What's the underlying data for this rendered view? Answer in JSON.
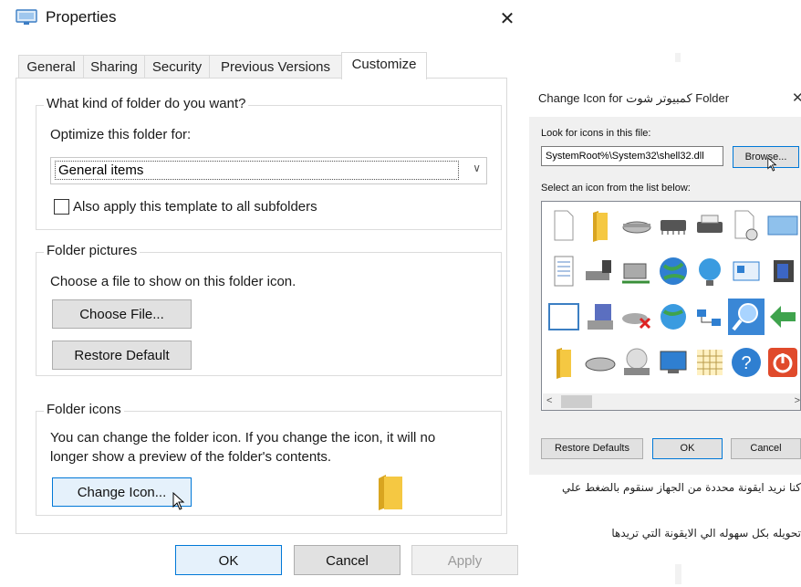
{
  "properties_dialog": {
    "title": "Properties",
    "close_glyph": "✕",
    "tabs": [
      "General",
      "Sharing",
      "Security",
      "Previous Versions",
      "Customize"
    ],
    "active_tab": "Customize",
    "folder_type_group": {
      "legend": "What kind of folder do you want?",
      "optimize_label": "Optimize this folder for:",
      "optimize_value": "General items",
      "apply_subfolders_label": "Also apply this template to all subfolders",
      "apply_subfolders_checked": false
    },
    "folder_pictures_group": {
      "legend": "Folder pictures",
      "description": "Choose a file to show on this folder icon.",
      "choose_file_button": "Choose File...",
      "restore_default_button": "Restore Default"
    },
    "folder_icons_group": {
      "legend": "Folder icons",
      "description_line1": "You can change the folder icon. If you change the icon, it will no",
      "description_line2": "longer show a preview of the folder's contents.",
      "change_icon_button": "Change Icon..."
    },
    "footer": {
      "ok": "OK",
      "cancel": "Cancel",
      "apply": "Apply"
    }
  },
  "change_icon_dialog": {
    "title": "Change Icon for كمبيوتر شوت Folder",
    "close_glyph": "✕",
    "look_for_label": "Look for icons in this file:",
    "file_path": "SystemRoot%\\System32\\shell32.dll",
    "browse_button": "Browse...",
    "select_label": "Select an icon from the list below:",
    "icons": [
      "blank-document-icon",
      "folder-icon",
      "drive-icon",
      "chip-icon",
      "printer-icon",
      "clock-document-icon",
      "window-icon",
      "text-document-icon",
      "network-drive-icon",
      "network-computer-icon",
      "globe-icon",
      "network-globe-icon",
      "control-panel-icon",
      "shield-icon",
      "blank-window-icon",
      "floppy-computer-icon",
      "disconnected-drive-icon",
      "internet-globe-icon",
      "network-share-icon",
      "search-icon",
      "back-arrow-icon",
      "folder-icon",
      "hard-drive-icon",
      "cd-drive-icon",
      "monitor-icon",
      "grid-icon",
      "help-icon",
      "power-icon"
    ],
    "selected_icon": "search-icon",
    "restore_defaults_button": "Restore Defaults",
    "ok_button": "OK",
    "cancel_button": "Cancel"
  },
  "captions": {
    "line1": "كنا نريد ايقونة محددة من الجهاز سنقوم بالضغط علي",
    "line2": "تحويله بكل سهوله الي الايقونة التي تريدها"
  },
  "colors": {
    "accent": "#0078d7",
    "selected_icon_bg": "#3a87d6",
    "folder_yellow": "#f5c842"
  }
}
